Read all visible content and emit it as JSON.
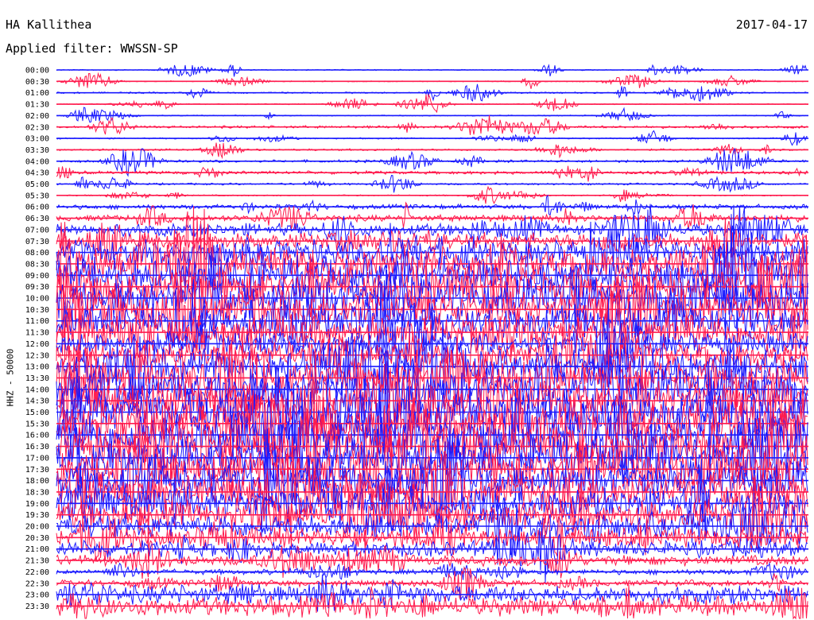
{
  "header": {
    "station": "HA Kallithea",
    "date": "2017-04-17",
    "filter": "Applied filter: WWSSN-SP"
  },
  "chart_data": {
    "type": "line",
    "title": "HA Kallithea",
    "ylabel": "HHZ - 50000",
    "colors": {
      "odd": "#1a1aff",
      "even": "#ff1a4d"
    },
    "rows": [
      "00:00",
      "00:30",
      "01:00",
      "01:30",
      "02:00",
      "02:30",
      "03:00",
      "03:30",
      "04:00",
      "04:30",
      "05:00",
      "05:30",
      "06:00",
      "06:30",
      "07:00",
      "07:30",
      "08:00",
      "08:30",
      "09:00",
      "09:30",
      "10:00",
      "10:30",
      "11:00",
      "11:30",
      "12:00",
      "12:30",
      "13:00",
      "13:30",
      "14:00",
      "14:30",
      "15:00",
      "15:30",
      "16:00",
      "16:30",
      "17:00",
      "17:30",
      "18:00",
      "18:30",
      "19:00",
      "19:30",
      "20:00",
      "20:30",
      "21:00",
      "21:30",
      "22:00",
      "22:30",
      "23:00",
      "23:30"
    ],
    "amplitude": [
      0.08,
      0.08,
      0.12,
      0.07,
      0.08,
      0.2,
      0.1,
      0.15,
      0.2,
      0.25,
      0.15,
      0.1,
      0.35,
      0.5,
      1.0,
      1.2,
      2.0,
      2.5,
      2.8,
      3.0,
      3.0,
      3.0,
      2.8,
      2.5,
      1.8,
      2.0,
      2.6,
      3.0,
      3.2,
      3.4,
      3.5,
      3.5,
      3.5,
      3.4,
      3.4,
      3.2,
      3.0,
      2.8,
      2.4,
      2.2,
      1.8,
      1.5,
      1.2,
      0.8,
      0.4,
      0.5,
      1.4,
      1.5
    ]
  }
}
